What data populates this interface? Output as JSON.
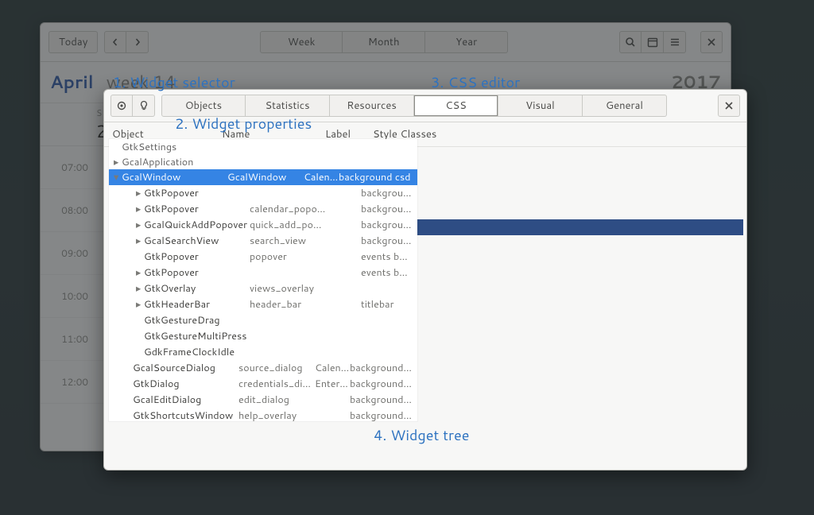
{
  "calendar": {
    "today_btn": "Today",
    "views": [
      "Week",
      "Month",
      "Year"
    ],
    "month": "April",
    "week_label": "week 14",
    "year": "2017",
    "day_head": {
      "label": "SUN",
      "num": "2"
    },
    "hours": [
      "07:00",
      "08:00",
      "09:00",
      "10:00",
      "11:00",
      "12:00"
    ]
  },
  "inspector": {
    "tabs": [
      "Objects",
      "Statistics",
      "Resources",
      "CSS",
      "Visual",
      "General"
    ],
    "active_tab": "CSS",
    "columns": {
      "object": "Object",
      "name": "Name",
      "label": "Label",
      "style": "Style Classes"
    },
    "pretree": [
      {
        "object": "GtkSettings"
      },
      {
        "object": "GcalApplication"
      }
    ],
    "selected": {
      "object": "GcalWindow",
      "name": "GcalWindow",
      "label": "Calen…",
      "style": "background csd"
    },
    "children": [
      {
        "object": "GtkPopover",
        "name": "",
        "label": "",
        "style": "background menu",
        "tri": true
      },
      {
        "object": "GtkPopover",
        "name": "calendar_popover",
        "label": "",
        "style": "background",
        "tri": true
      },
      {
        "object": "GcalQuickAddPopover",
        "name": "quick_add_popover",
        "label": "",
        "style": "background",
        "tri": true
      },
      {
        "object": "GcalSearchView",
        "name": "search_view",
        "label": "",
        "style": "background",
        "tri": true
      },
      {
        "object": "GtkPopover",
        "name": "popover",
        "label": "",
        "style": "events background",
        "tri": false
      },
      {
        "object": "GtkPopover",
        "name": "",
        "label": "",
        "style": "events background",
        "tri": true
      },
      {
        "object": "GtkOverlay",
        "name": "views_overlay",
        "label": "",
        "style": "",
        "tri": true
      },
      {
        "object": "GtkHeaderBar",
        "name": "header_bar",
        "label": "",
        "style": "titlebar",
        "tri": true
      },
      {
        "object": "GtkGestureDrag",
        "name": "",
        "label": "",
        "style": "",
        "tri": false
      },
      {
        "object": "GtkGestureMultiPress",
        "name": "",
        "label": "",
        "style": "",
        "tri": false
      },
      {
        "object": "GdkFrameClockIdle",
        "name": "",
        "label": "",
        "style": "",
        "tri": false
      }
    ],
    "siblings": [
      {
        "object": "GcalSourceDialog",
        "name": "source_dialog",
        "label": "Calen…",
        "style": "background csd"
      },
      {
        "object": "GtkDialog",
        "name": "credentials_dialog",
        "label": "Enter …",
        "style": "background csd"
      },
      {
        "object": "GcalEditDialog",
        "name": "edit_dialog",
        "label": "",
        "style": "background csd"
      },
      {
        "object": "GtkShortcutsWindow",
        "name": "help_overlay",
        "label": "",
        "style": "background csd"
      }
    ]
  },
  "annotations": {
    "a1": "1. Widget selector",
    "a2": "2. Widget properties",
    "a3": "3. CSS editor",
    "a4": "4. Widget tree"
  }
}
